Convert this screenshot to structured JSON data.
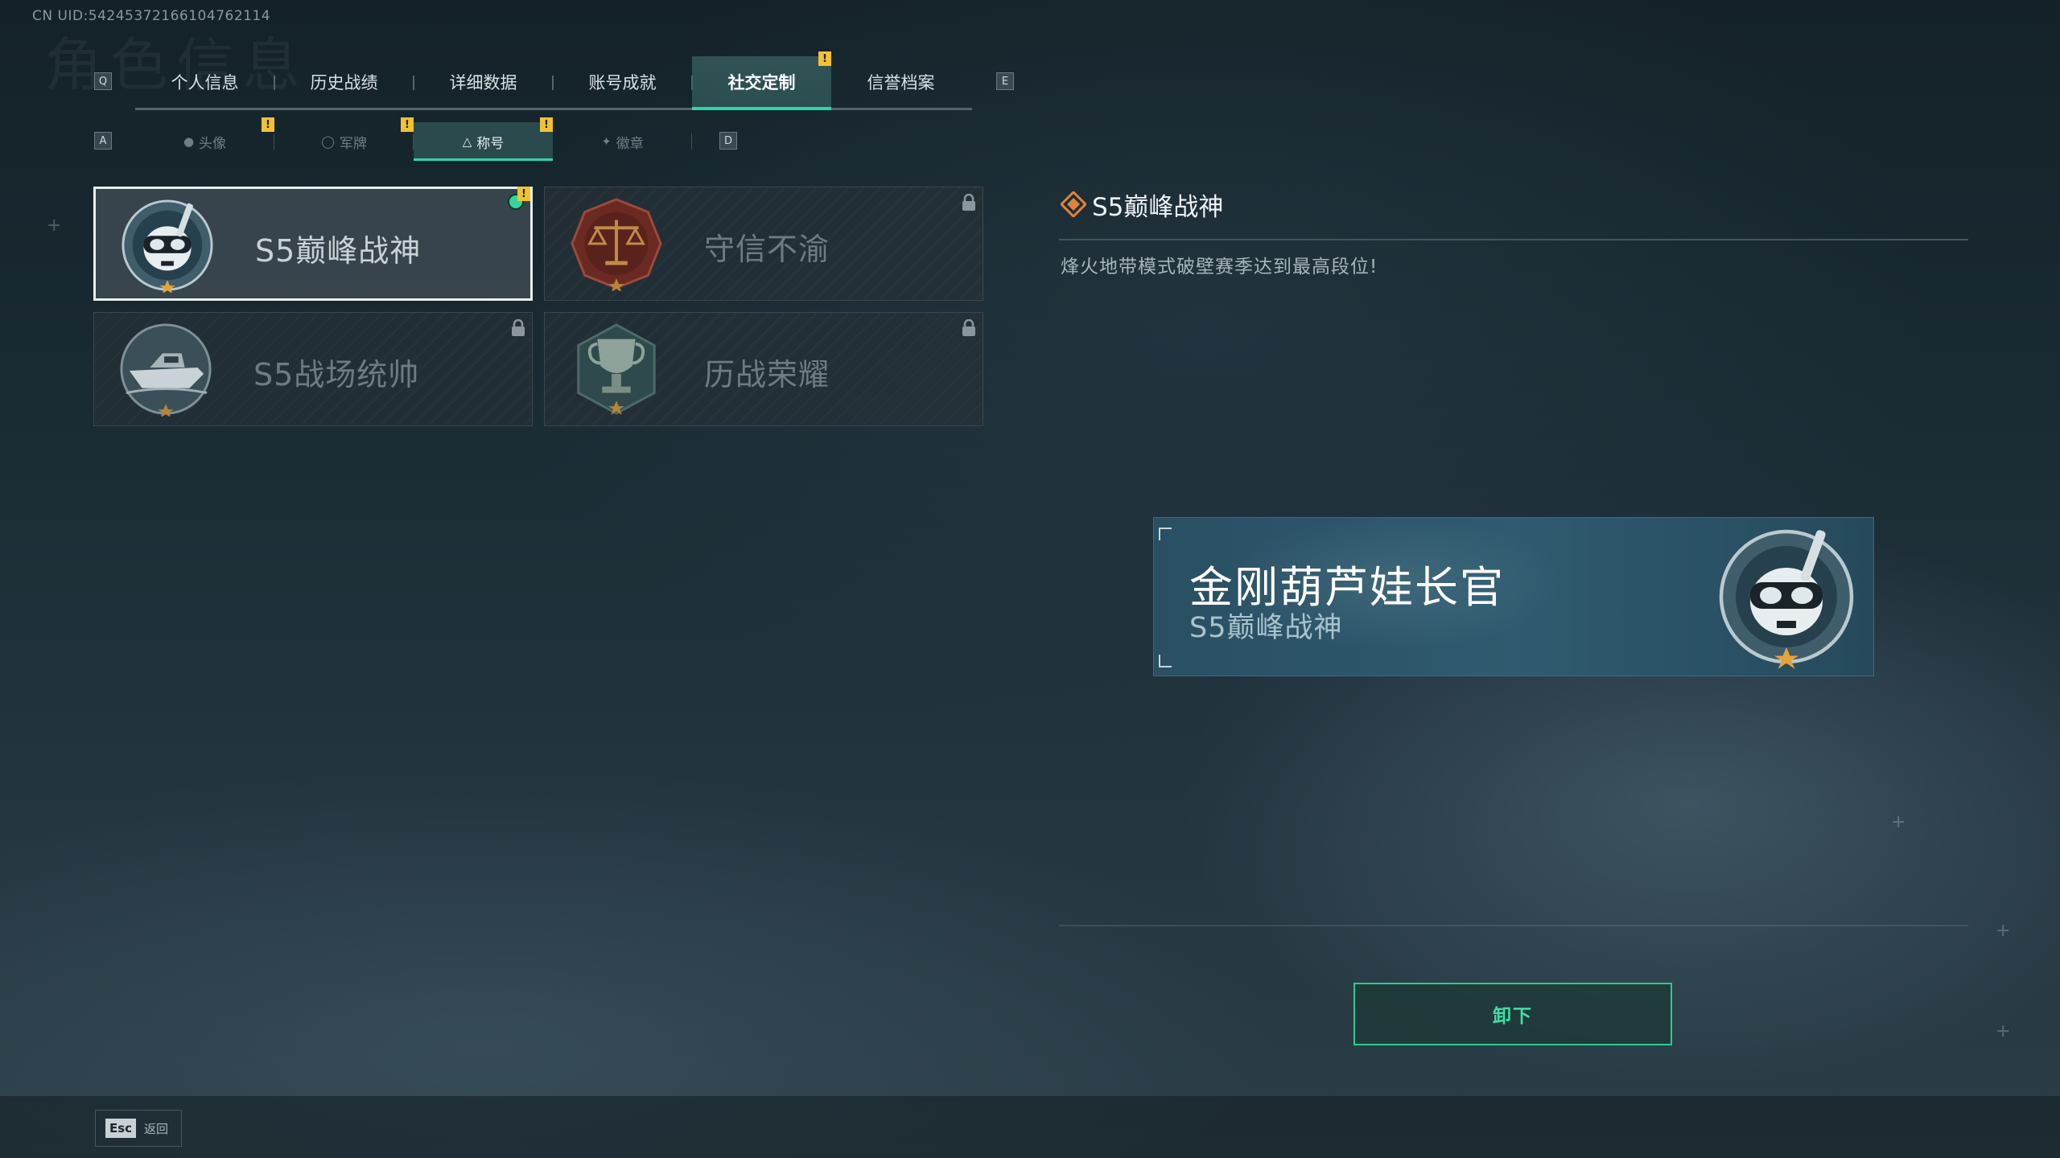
{
  "header": {
    "uid": "CN UID:5424537216610476211​4"
  },
  "main_tabs": {
    "prev_key": "Q",
    "next_key": "E",
    "items": [
      {
        "label": "个人信息"
      },
      {
        "label": "历史战绩"
      },
      {
        "label": "详细数据"
      },
      {
        "label": "账号成就"
      },
      {
        "label": "社交定制",
        "active": true,
        "badge": "!"
      },
      {
        "label": "信誉档案"
      }
    ]
  },
  "sub_tabs": {
    "prev_key": "A",
    "next_key": "D",
    "items": [
      {
        "label": "头像",
        "icon": "person-icon",
        "badge": "!"
      },
      {
        "label": "军牌",
        "icon": "dogtag-icon",
        "badge": "!"
      },
      {
        "label": "称号",
        "icon": "title-icon",
        "active": true,
        "badge": "!"
      },
      {
        "label": "徽章",
        "icon": "medal-icon"
      }
    ]
  },
  "titles": [
    {
      "name": "S5巅峰战神",
      "emblem": "diver-skull-emblem",
      "selected": true,
      "equipped": true,
      "badge": "!"
    },
    {
      "name": "守信不渝",
      "emblem": "scales-emblem",
      "locked": true
    },
    {
      "name": "S5战场统帅",
      "emblem": "boat-emblem",
      "locked": true
    },
    {
      "name": "历战荣耀",
      "emblem": "trophy-emblem",
      "locked": true
    }
  ],
  "detail": {
    "name": "S5巅峰战神",
    "description": "烽火地带模式破壁赛季达到最高段位!"
  },
  "preview": {
    "player_name": "金刚葫芦娃长官",
    "title": "S5巅峰战神"
  },
  "actions": {
    "unequip_label": "卸下"
  },
  "footer": {
    "esc_key": "Esc",
    "back_label": "返回"
  },
  "colors": {
    "accent": "#2fd5a5",
    "badge": "#f1c232",
    "background": "#1b2c35"
  }
}
